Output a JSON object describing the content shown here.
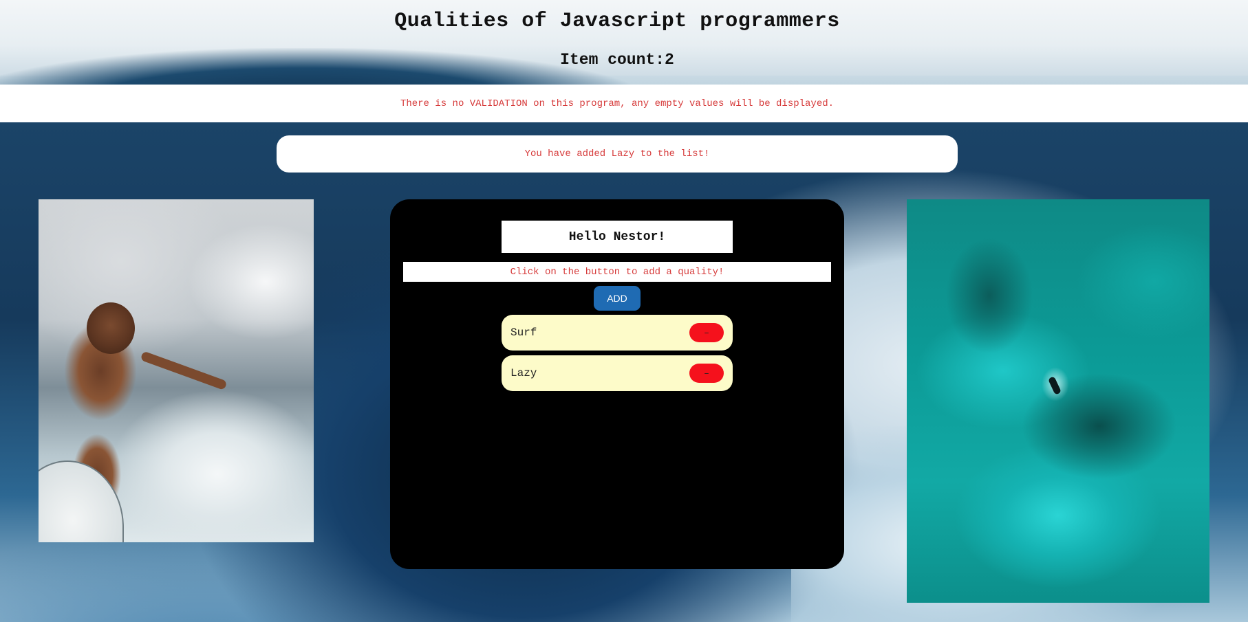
{
  "header": {
    "title": "Qualities of Javascript programmers",
    "item_count": "Item count:2"
  },
  "warning": {
    "text": "There is no VALIDATION on this program, any empty values will be displayed."
  },
  "notice": {
    "text": "You have added Lazy to the list!"
  },
  "panel": {
    "greeting": "Hello Nestor!",
    "instruction": "Click on the button to add a quality!",
    "add_label": "ADD",
    "items": [
      {
        "label": "Surf",
        "remove_label": "–"
      },
      {
        "label": "Lazy",
        "remove_label": "–"
      }
    ]
  },
  "images": {
    "left": "surfer riding a wave",
    "right": "aerial view of swimmer in turquoise sea"
  },
  "colors": {
    "accent_red": "#d63a3a",
    "button_blue": "#1f6bb3",
    "remove_red": "#f5111c",
    "item_bg": "#fdfbc9",
    "panel_bg": "#000000"
  }
}
